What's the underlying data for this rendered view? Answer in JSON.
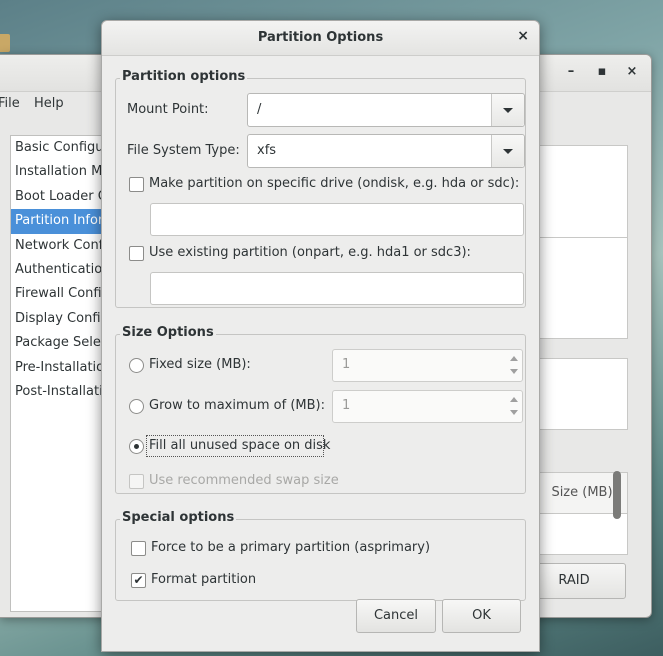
{
  "background_window": {
    "controls": {
      "minimize": "–",
      "maximize": "▪",
      "close": "×"
    },
    "menu": [
      "File",
      "Help"
    ],
    "sidebar_items": [
      "Basic Configuration",
      "Installation Method",
      "Boot Loader Options",
      "Partition Information",
      "Network Configuration",
      "Authentication",
      "Firewall Configuration",
      "Display Configuration",
      "Package Selection",
      "Pre-Installation Script",
      "Post-Installation Script"
    ],
    "selected_index": 3,
    "table_header": "Size (MB)",
    "raid_button": "RAID"
  },
  "dialog": {
    "title": "Partition Options",
    "close": "×",
    "partition_options": {
      "label": "Partition options",
      "mount_point_label": "Mount Point:",
      "mount_point_value": "/",
      "fs_type_label": "File System Type:",
      "fs_type_value": "xfs",
      "ondisk_label": "Make partition on specific drive (ondisk, e.g. hda or sdc):",
      "ondisk_value": "",
      "onpart_label": "Use existing partition (onpart, e.g. hda1 or sdc3):",
      "onpart_value": ""
    },
    "size_options": {
      "label": "Size Options",
      "fixed_label": "Fixed size (MB):",
      "fixed_value": "1",
      "grow_label": "Grow to maximum of (MB):",
      "grow_value": "1",
      "fill_label": "Fill all unused space on disk",
      "swap_label": "Use recommended swap size"
    },
    "special_options": {
      "label": "Special options",
      "primary_label": "Force to be a primary partition (asprimary)",
      "format_label": "Format partition",
      "check_mark": "✔"
    },
    "cancel": "Cancel",
    "ok": "OK"
  }
}
